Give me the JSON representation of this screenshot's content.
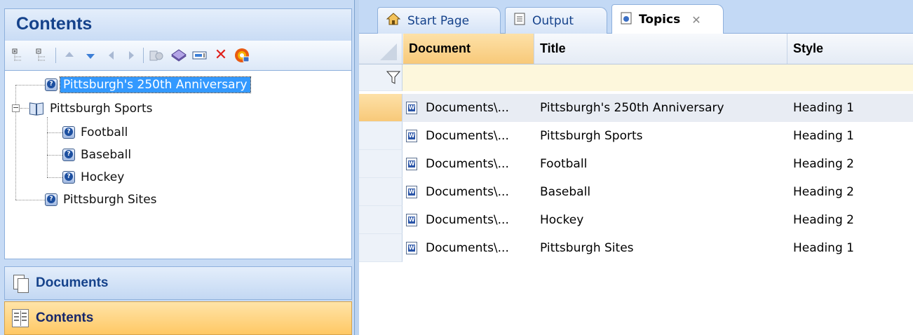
{
  "left_panel": {
    "header_title": "Contents",
    "toolbar_icons": [
      "expand-all-icon",
      "collapse-all-icon",
      "move-up-icon",
      "move-down-icon",
      "move-left-icon",
      "move-right-icon",
      "properties-icon",
      "book-icon",
      "rename-icon",
      "delete-icon",
      "help-topic-icon"
    ],
    "tree": [
      {
        "label": "Pittsburgh's 250th Anniversary",
        "type": "topic",
        "selected": true
      },
      {
        "label": "Pittsburgh Sports",
        "type": "book",
        "expanded": true
      },
      {
        "label": "Football",
        "type": "topic"
      },
      {
        "label": "Baseball",
        "type": "topic"
      },
      {
        "label": "Hockey",
        "type": "topic"
      },
      {
        "label": "Pittsburgh Sites",
        "type": "topic"
      }
    ],
    "nav": [
      {
        "label": "Documents",
        "icon": "documents-icon"
      },
      {
        "label": "Contents",
        "icon": "contents-icon",
        "active": true
      }
    ]
  },
  "tabs": [
    {
      "label": "Start Page",
      "icon": "home-icon"
    },
    {
      "label": "Output",
      "icon": "output-icon"
    },
    {
      "label": "Topics",
      "icon": "topic-icon",
      "active": true,
      "close": "✕"
    }
  ],
  "grid": {
    "columns": [
      "Document",
      "Title",
      "Style"
    ],
    "rows": [
      {
        "document": "Documents\\...",
        "title": "Pittsburgh's 250th Anniversary",
        "style": "Heading 1"
      },
      {
        "document": "Documents\\...",
        "title": "Pittsburgh Sports",
        "style": "Heading 1"
      },
      {
        "document": "Documents\\...",
        "title": "Football",
        "style": "Heading 2"
      },
      {
        "document": "Documents\\...",
        "title": "Baseball",
        "style": "Heading 2"
      },
      {
        "document": "Documents\\...",
        "title": "Hockey",
        "style": "Heading 2"
      },
      {
        "document": "Documents\\...",
        "title": "Pittsburgh Sites",
        "style": "Heading 1"
      }
    ]
  },
  "colors": {
    "header_blue": "#15428b",
    "accent_orange": "#f8c979",
    "selection": "#3399ff",
    "pane_blue": "#c7dbf5"
  }
}
